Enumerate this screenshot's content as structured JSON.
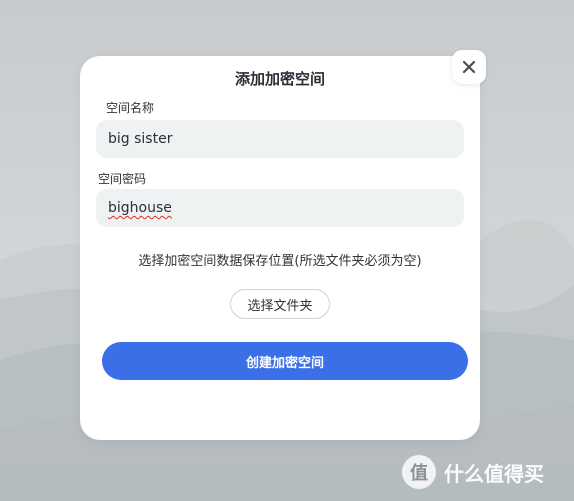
{
  "dialog": {
    "title": "添加加密空间",
    "close_icon": "close-icon",
    "name_label": "空间名称",
    "name_value": "big sister",
    "password_label": "空间密码",
    "password_value": "bighouse",
    "hint": "选择加密空间数据保存位置(所选文件夹必须为空)",
    "choose_folder_label": "选择文件夹",
    "create_label": "创建加密空间"
  },
  "watermark": {
    "logo_glyph": "值",
    "text": "什么值得买"
  },
  "colors": {
    "accent": "#3b6fe8",
    "field_bg": "#eef2f3",
    "dialog_bg": "#ffffff"
  }
}
